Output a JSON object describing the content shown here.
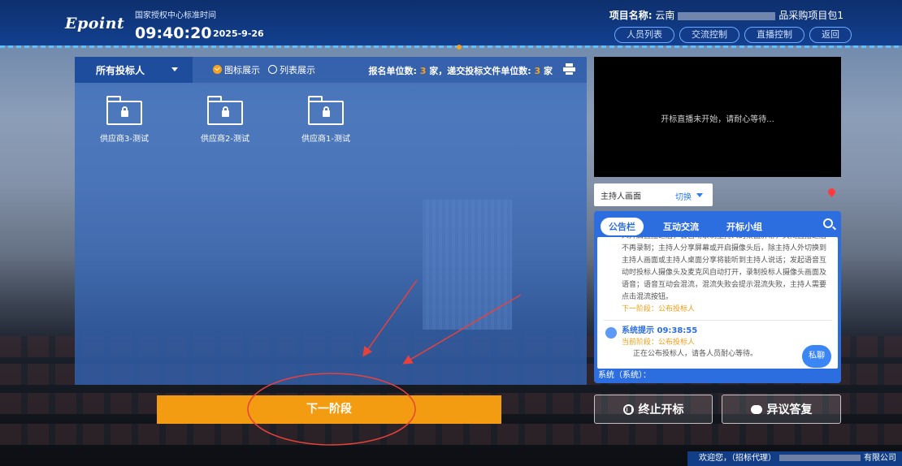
{
  "header": {
    "logo": "Epoint",
    "clock_label": "国家授权中心标准时间",
    "time": "09:40:20",
    "date": "2025-9-26",
    "project_label": "项目名称:",
    "project_prefix": "云南",
    "project_suffix": "品采购项目包1",
    "buttons": [
      "人员列表",
      "交流控制",
      "直播控制",
      "返回"
    ]
  },
  "bidders": {
    "select_label": "所有投标人",
    "view_icon": "图标展示",
    "view_list": "列表展示",
    "counts_prefix": "报名单位数:",
    "reg_count": "3",
    "counts_mid": "家，递交投标文件单位数:",
    "submit_count": "3",
    "counts_suffix": "家",
    "folders": [
      "供应商3-测试",
      "供应商2-测试",
      "供应商1-测试"
    ]
  },
  "next_button": "下一阶段",
  "video": {
    "message": "开标直播未开始，请耐心等待...",
    "host_label": "主持人画面",
    "switch_label": "切换"
  },
  "bulletin": {
    "tabs": [
      "公告栏",
      "互动交流",
      "开标小组"
    ],
    "notice": "人开启直播之后，会自动录制主持人的桌面屏幕，关闭直播之后不再录制；主持人分享屏幕或开启摄像头后，除主持人外切换到主持人画面或主持人桌面分享将能听到主持人说话；发起语音互动时投标人摄像头及麦克风自动打开，录制投标人摄像头画面及语音；语音互动会混流，混流失败会提示混流失败，主持人需要点击混流按钮。",
    "notice_next": "下一阶段：公布投标人",
    "sys_title": "系统提示 09:38:55",
    "sys_phase": "当前阶段：公布投标人",
    "sys_message": "正在公布投标人，请各人员耐心等待。",
    "private_chat": "私聊",
    "footer": "系统（系统）："
  },
  "actions": {
    "stop": "终止开标",
    "objection": "异议答复"
  },
  "footer": {
    "welcome": "欢迎您，（招标代理）",
    "company_suffix": "有限公司"
  },
  "colors": {
    "header": "#12408f",
    "accent_orange": "#f39c12",
    "panel_blue": "#2c6ee0",
    "annotation_red": "#e8413c"
  }
}
